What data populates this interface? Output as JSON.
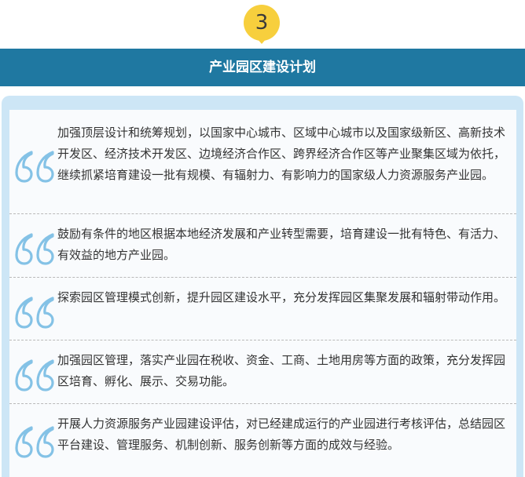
{
  "badge": {
    "number": "3"
  },
  "header": {
    "title": "产业园区建设计划"
  },
  "items": [
    {
      "text": "加强顶层设计和统筹规划，以国家中心城市、区域中心城市以及国家级新区、高新技术开发区、经济技术开发区、边境经济合作区、跨界经济合作区等产业聚集区域为依托，继续抓紧培育建设一批有规模、有辐射力、有影响力的国家级人力资源服务产业园。"
    },
    {
      "text": "鼓励有条件的地区根据本地经济发展和产业转型需要，培育建设一批有特色、有活力、有效益的地方产业园。"
    },
    {
      "text": "探索园区管理模式创新，提升园区建设水平，充分发挥园区集聚发展和辐射带动作用。"
    },
    {
      "text": "加强园区管理，落实产业园在税收、资金、工商、土地用房等方面的政策，充分发挥园区培育、孵化、展示、交易功能。"
    },
    {
      "text": "开展人力资源服务产业园建设评估，对已经建成运行的产业园进行考核评估，总结园区平台建设、管理服务、机制创新、服务创新等方面的成效与经验。"
    }
  ],
  "colors": {
    "banner": "#1f78a1",
    "badge": "#f7cf3d",
    "panel": "#cde6f6",
    "quote": "#84c2e6"
  },
  "icons": {
    "quote": "quote-mark-icon"
  }
}
